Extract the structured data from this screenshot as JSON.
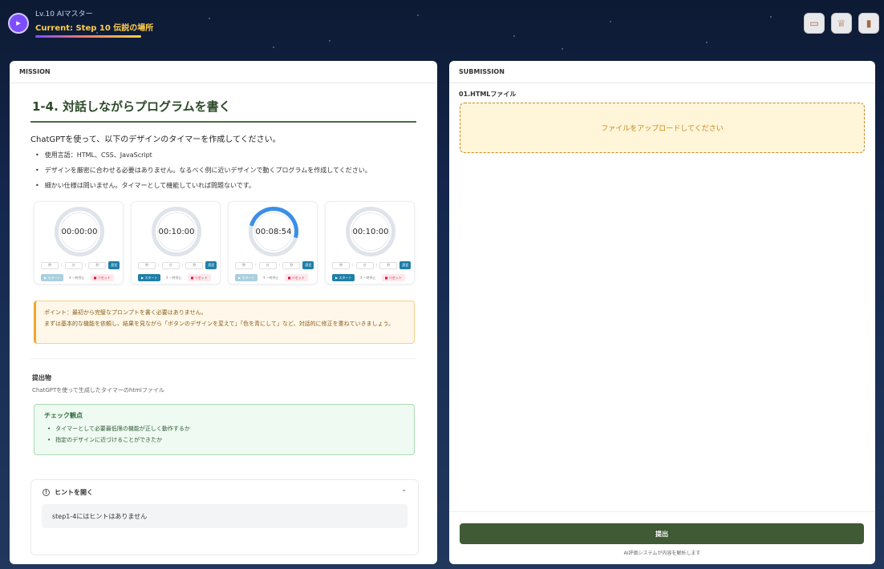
{
  "header": {
    "level": "Lv.10 AIマスター",
    "current": "Current: Step 10 伝説の場所",
    "icons": [
      "book-icon",
      "trophy-icon",
      "scroll-icon"
    ]
  },
  "mission": {
    "heading": "MISSION",
    "title": "1-4. 対話しながらプログラムを書く",
    "lead": "ChatGPTを使って、以下のデザインのタイマーを作成してください。",
    "bullets": [
      "使用言語：HTML、CSS、JavaScript",
      "デザインを厳密に合わせる必要はありません。なるべく例に近いデザインで動くプログラムを作成してください。",
      "細かい仕様は問いません。タイマーとして機能していれば問題ないです。"
    ],
    "timers": [
      {
        "time": "00:00:00",
        "progress": 0
      },
      {
        "time": "00:10:00",
        "progress": 0
      },
      {
        "time": "00:08:54",
        "progress": 0.11
      },
      {
        "time": "00:10:00",
        "progress": 0
      }
    ],
    "timer_inputs": [
      "時",
      "分",
      "秒"
    ],
    "timer_set": "設定",
    "timer_buttons": {
      "start": "▶ スタート",
      "pause": "Ⅱ 一時停止",
      "reset": "■ リセット"
    },
    "point": {
      "line1": "ポイント：最初から完璧なプロンプトを書く必要はありません。",
      "line2": "まずは基本的な機能を依頼し、結果を見ながら「ボタンのデザインを変えて」「色を青にして」など、対話的に修正を重ねていきましょう。"
    },
    "deliverable_label": "提出物",
    "deliverable_desc": "ChatGPTを使って生成したタイマーのhtmlファイル",
    "check": {
      "title": "チェック観点",
      "items": [
        "タイマーとして必要最低限の機能が正しく動作するか",
        "指定のデザインに近づけることができたか"
      ]
    },
    "hint": {
      "label": "ヒントを開く",
      "body": "step1-4にはヒントはありません"
    }
  },
  "submission": {
    "heading": "SUBMISSION",
    "file_label": "01.HTMLファイル",
    "drop_text": "ファイルをアップロードしてください",
    "submit": "提出",
    "note": "AI評価システムが内容を解析します"
  },
  "colors": {
    "accent_green": "#3f5a35",
    "timer_blue": "#3b8fe6",
    "warning": "#f0a830"
  }
}
